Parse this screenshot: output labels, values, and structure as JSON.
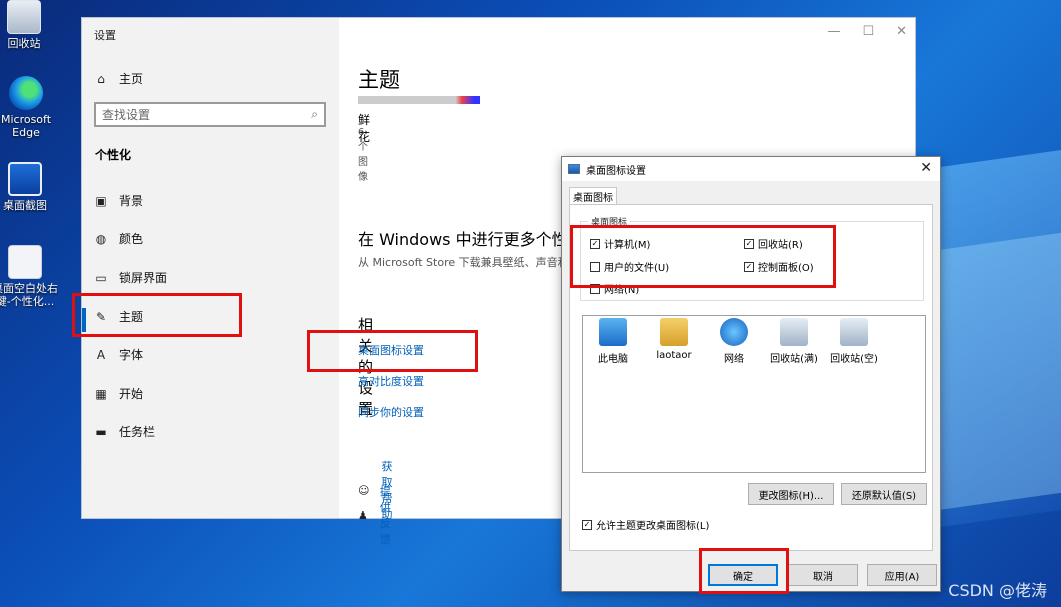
{
  "desktop": {
    "icons": [
      {
        "label": "回收站",
        "icon": "recycle-bin-icon"
      },
      {
        "label": "Microsoft Edge",
        "icon": "edge-icon"
      },
      {
        "label": "桌面截图",
        "icon": "screenshot-icon"
      },
      {
        "label": "桌面空白处右键-个性化...",
        "icon": "document-icon"
      }
    ],
    "watermark": "CSDN @佬涛"
  },
  "settings": {
    "window_title": "设置",
    "controls": {
      "minimize": "—",
      "maximize": "☐",
      "close": "✕"
    },
    "sidebar": {
      "home": "主页",
      "search_placeholder": "查找设置",
      "section": "个性化",
      "items": [
        {
          "label": "背景",
          "icon": "picture-icon"
        },
        {
          "label": "颜色",
          "icon": "palette-icon"
        },
        {
          "label": "锁屏界面",
          "icon": "lock-screen-icon"
        },
        {
          "label": "主题",
          "icon": "theme-brush-icon"
        },
        {
          "label": "字体",
          "icon": "font-icon"
        },
        {
          "label": "开始",
          "icon": "start-icon"
        },
        {
          "label": "任务栏",
          "icon": "taskbar-icon"
        }
      ]
    },
    "main": {
      "title": "主题",
      "theme_name": "鲜花",
      "theme_count": "6 个图像",
      "more_title": "在 Windows 中进行更多个性",
      "more_desc": "从 Microsoft Store 下载兼具壁纸、声音和",
      "related_title": "相关的设置",
      "links": [
        "桌面图标设置",
        "高对比度设置",
        "同步你的设置"
      ],
      "help": "获取帮助",
      "feedback": "提供反馈"
    }
  },
  "dialog": {
    "title": "桌面图标设置",
    "close": "✕",
    "tab": "桌面图标",
    "group_label": "桌面图标",
    "checkboxes": [
      {
        "label": "计算机(M)",
        "checked": true
      },
      {
        "label": "回收站(R)",
        "checked": true
      },
      {
        "label": "用户的文件(U)",
        "checked": false
      },
      {
        "label": "控制面板(O)",
        "checked": true
      },
      {
        "label": "网络(N)",
        "checked": false
      }
    ],
    "icons": [
      {
        "label": "此电脑",
        "icon": "computer-icon"
      },
      {
        "label": "laotaor",
        "icon": "user-folder-icon"
      },
      {
        "label": "网络",
        "icon": "network-icon"
      },
      {
        "label": "回收站(满)",
        "icon": "recycle-bin-full-icon"
      },
      {
        "label": "回收站(空)",
        "icon": "recycle-bin-empty-icon"
      }
    ],
    "change_icon": "更改图标(H)...",
    "restore_default": "还原默认值(S)",
    "allow_themes": "允许主题更改桌面图标(L)",
    "allow_themes_checked": true,
    "ok": "确定",
    "cancel": "取消",
    "apply": "应用(A)"
  },
  "colors": {
    "accent": "#0067c0",
    "annotation": "#e01010",
    "link": "#0060b8"
  }
}
